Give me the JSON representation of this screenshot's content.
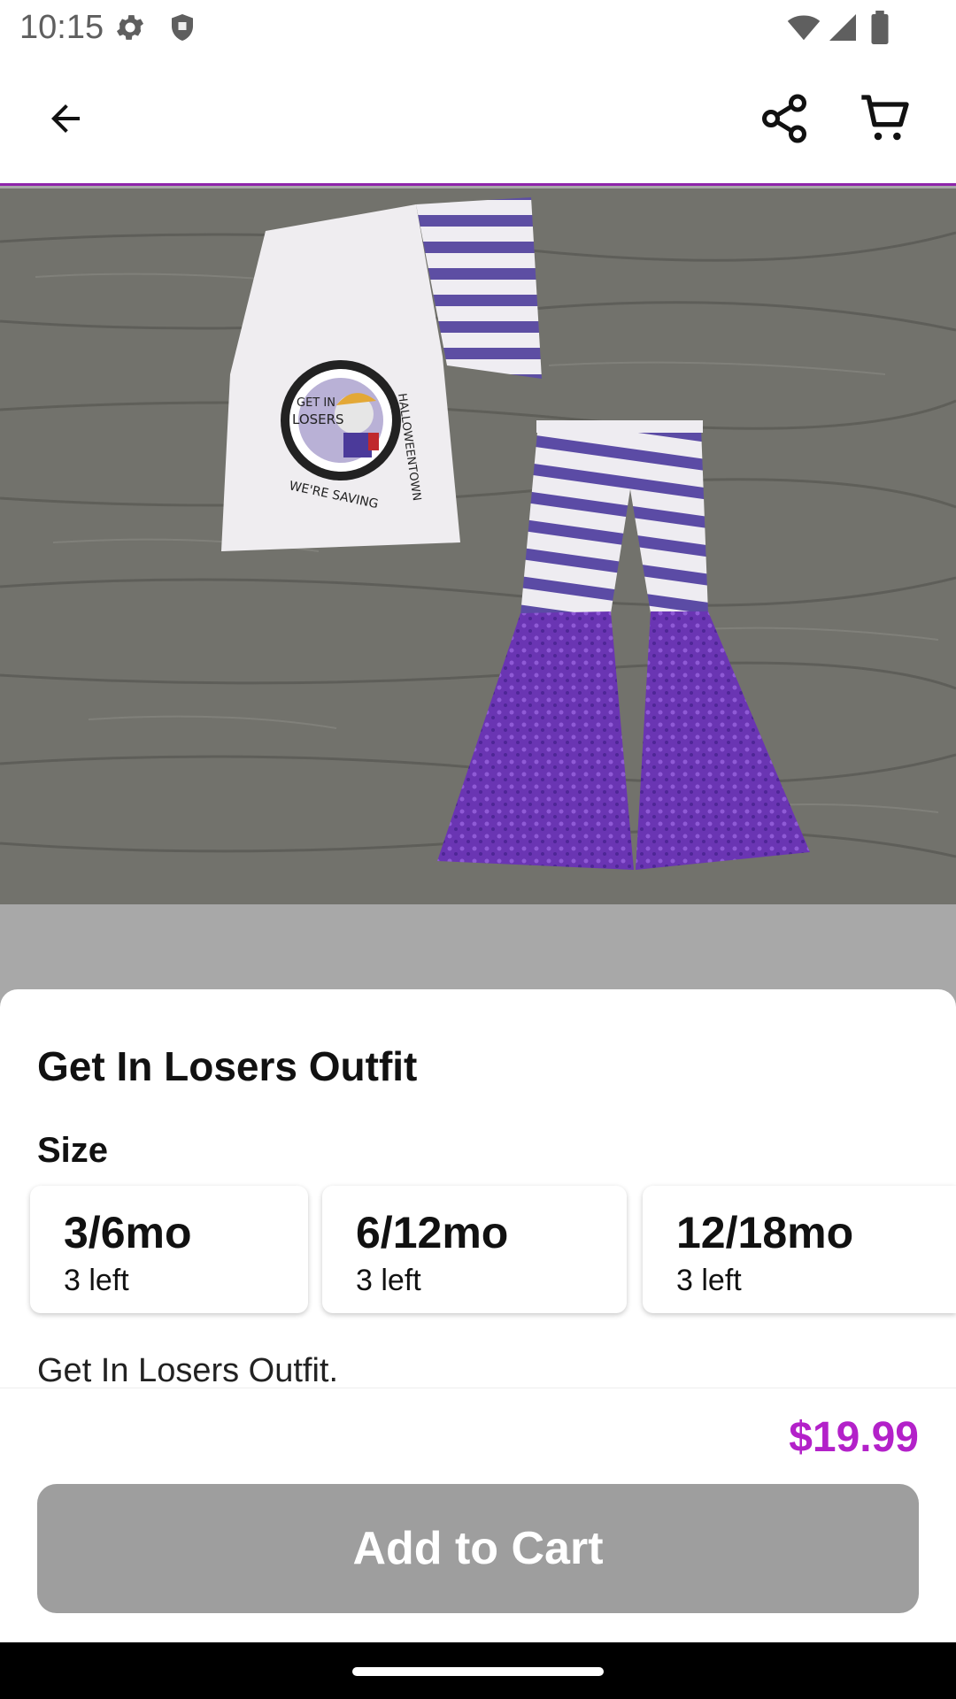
{
  "status_bar": {
    "time": "10:15",
    "icons": [
      "settings-icon",
      "shield-icon",
      "wifi-icon",
      "signal-icon",
      "battery-icon"
    ]
  },
  "app_bar": {
    "icons": [
      "back-arrow-icon",
      "share-icon",
      "cart-icon"
    ]
  },
  "product": {
    "title": "Get In Losers Outfit",
    "size_label": "Size",
    "sizes": [
      {
        "name": "3/6mo",
        "stock": "3 left"
      },
      {
        "name": "6/12mo",
        "stock": "3 left"
      },
      {
        "name": "12/18mo",
        "stock": "3 left"
      }
    ],
    "description": "Get In Losers Outfit.",
    "price": "$19.99",
    "image_text": {
      "badge_line1": "GET IN",
      "badge_line2": "LOSERS",
      "arc_left": "WE'RE SAVING",
      "arc_right": "HALLOWEENTOWN"
    }
  },
  "actions": {
    "add_to_cart": "Add to Cart"
  },
  "colors": {
    "accent": "#b321c9",
    "appbar_divider": "#8e24aa",
    "button_disabled": "#9e9e9e"
  }
}
